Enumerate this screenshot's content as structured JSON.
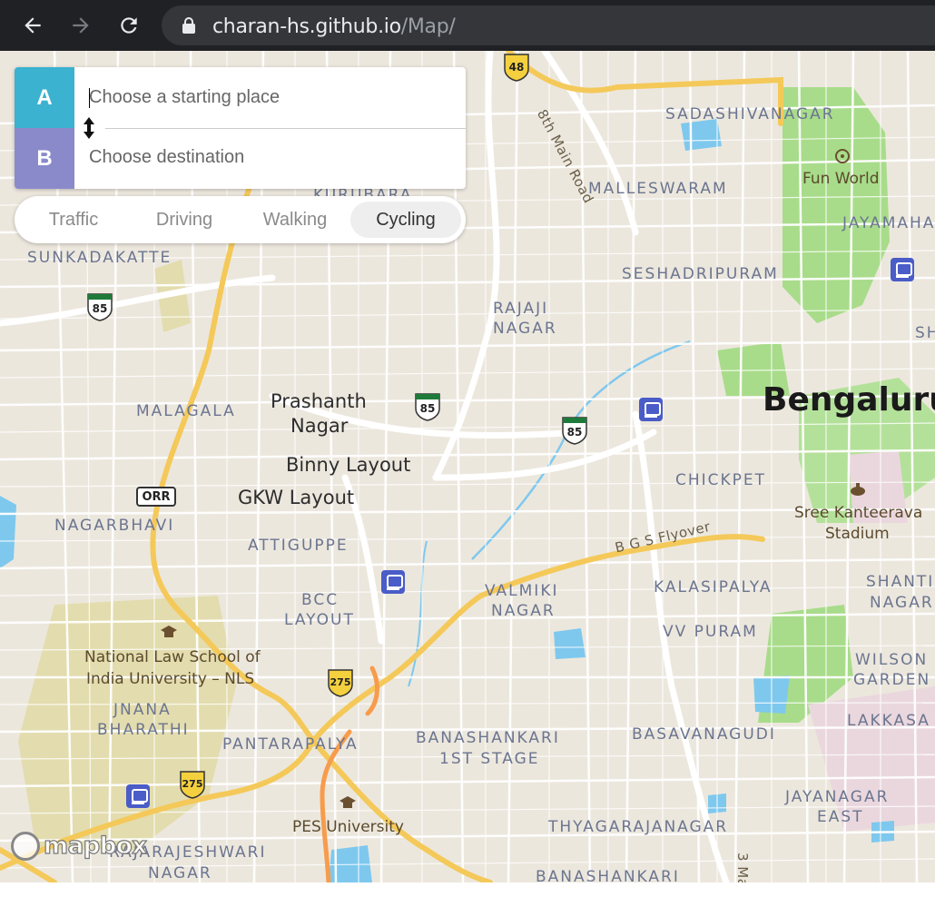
{
  "browser": {
    "url_host": "charan-hs.github.io",
    "url_path": "/Map/"
  },
  "directions": {
    "origin_tag": "A",
    "destination_tag": "B",
    "origin_placeholder": "Choose a starting place",
    "destination_placeholder": "Choose destination",
    "origin_value": "",
    "destination_value": ""
  },
  "modes": [
    {
      "label": "Traffic",
      "active": false
    },
    {
      "label": "Driving",
      "active": false
    },
    {
      "label": "Walking",
      "active": false
    },
    {
      "label": "Cycling",
      "active": true
    }
  ],
  "map": {
    "city": "Bengaluru",
    "areas": [
      "SADASHIVANAGAR",
      "MALLESWARAM",
      "JAYAMAHAL",
      "KURUBARA",
      "SUNKADAKATTE",
      "SESHADRIPURAM",
      "RAJAJI",
      "NAGAR",
      "MALAGALA",
      "CHICKPET",
      "NAGARBHAVI",
      "ATTIGUPPE",
      "BCC",
      "LAYOUT",
      "VALMIKI",
      "NAGAR",
      "KALASIPALYA",
      "SHANTI",
      "NAGAR",
      "VV PURAM",
      "WILSON",
      "GARDEN",
      "JNANA",
      "BHARATHI",
      "PANTARAPALYA",
      "BANASHANKARI",
      "1ST STAGE",
      "BASAVANAGUDI",
      "LAKKASA",
      "JAYANAGAR",
      "EAST",
      "THYAGARAJANAGAR",
      "RAJARAJESHWARI",
      "NAGAR",
      "BANASHANKARI",
      "SH"
    ],
    "places": [
      "Prashanth",
      "Nagar",
      "Binny Layout",
      "GKW Layout"
    ],
    "pois": [
      "Fun World",
      "Sree Kanteerava",
      "Stadium",
      "National Law School of",
      "India University – NLS",
      "PES University"
    ],
    "roads": [
      "8th Main Road",
      "B G S Flyover",
      "3 Ma"
    ],
    "shields": [
      "48",
      "85",
      "85",
      "85",
      "275",
      "275",
      "ORR"
    ],
    "attribution": "mapbox"
  },
  "colors": {
    "tag_a": "#3bb2d0",
    "tag_b": "#8a8acb",
    "land": "#ece7dd",
    "park": "#a8dc8a",
    "water": "#7ec8ee",
    "major_road": "#f4c959",
    "cycle_route": "#f79c4c"
  }
}
